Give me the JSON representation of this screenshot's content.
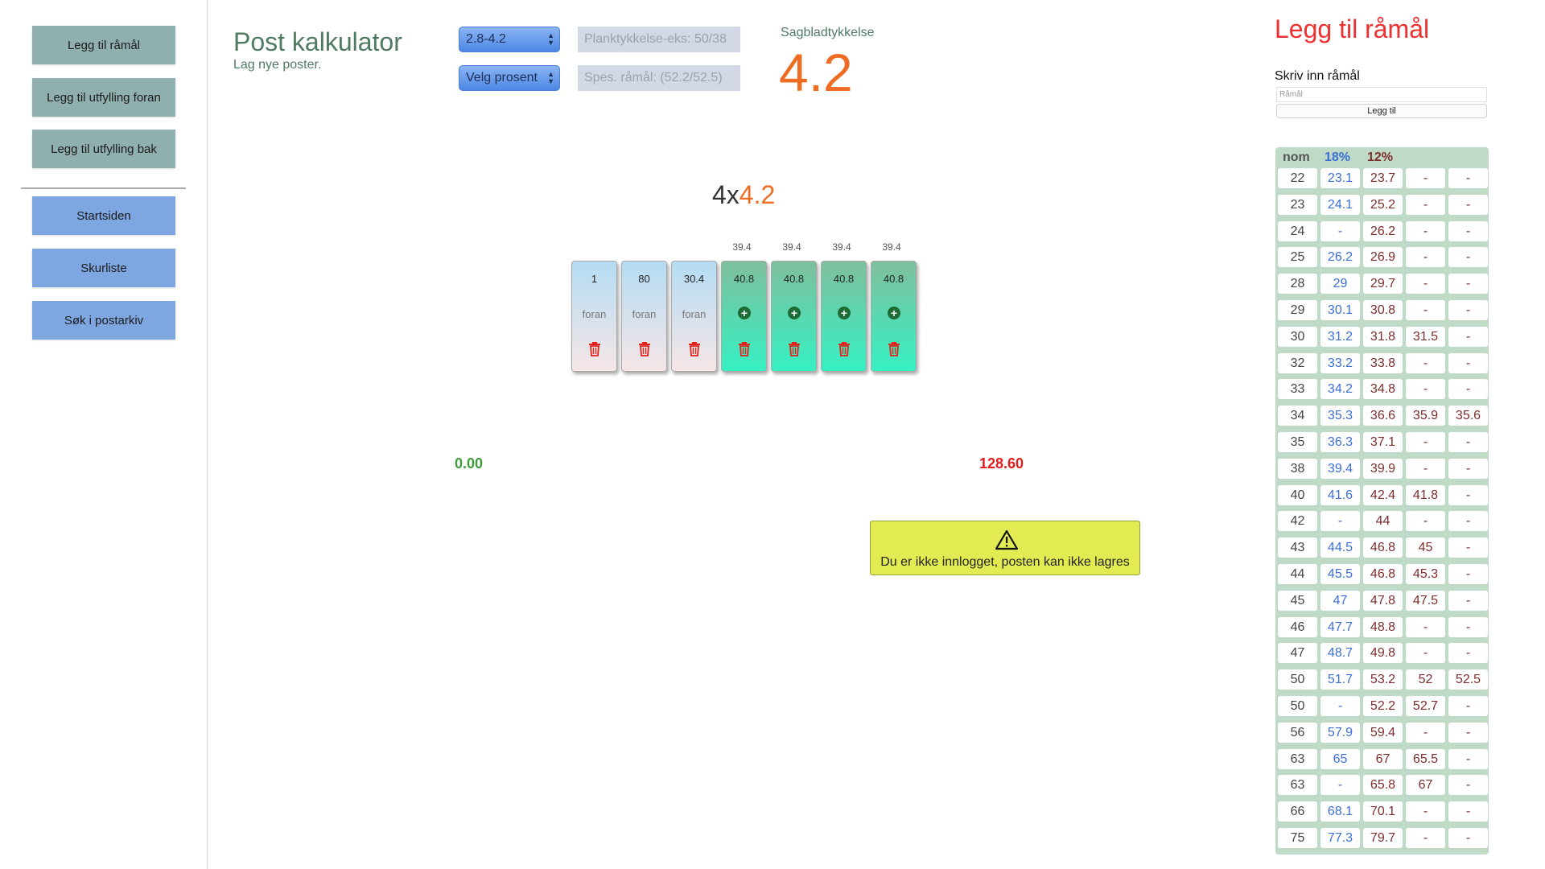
{
  "sidebar": {
    "top_buttons": [
      "Legg til råmål",
      "Legg til utfylling foran",
      "Legg til utfylling bak"
    ],
    "nav_buttons": [
      "Startsiden",
      "Skurliste",
      "Søk i postarkiv"
    ]
  },
  "header": {
    "title": "Post kalkulator",
    "subtitle": "Lag nye poster.",
    "range_select": "2.8-4.2",
    "percent_select": "Velg prosent",
    "plank_placeholder": "Planktykkelse-eks: 50/38",
    "spec_placeholder": "Spes. råmål: (52.2/52.5)",
    "blade_label": "Sagbladtykkelse",
    "blade_value": "4.2"
  },
  "post": {
    "count_prefix": "4x",
    "count_value": "4.2",
    "slot_tops": [
      "39.4",
      "39.4",
      "39.4",
      "39.4"
    ],
    "front_cards": [
      {
        "value": "1",
        "label": "foran"
      },
      {
        "value": "80",
        "label": "foran"
      },
      {
        "value": "30.4",
        "label": "foran"
      }
    ],
    "back_cards": [
      {
        "value": "40.8"
      },
      {
        "value": "40.8"
      },
      {
        "value": "40.8"
      },
      {
        "value": "40.8"
      }
    ],
    "total_left": "0.00",
    "total_right": "128.60",
    "warning": "Du er ikke innlogget, posten kan ikke lagres"
  },
  "right": {
    "title": "Legg til råmål",
    "label": "Skriv inn råmål",
    "placeholder": "Råmål",
    "button": "Legg til",
    "table_headers": [
      "nom",
      "18%",
      "12%"
    ],
    "header_colors": [
      "#555555",
      "#3c6fd6",
      "#7e2d2d"
    ],
    "rows": [
      [
        "22",
        "23.1",
        "23.7",
        "-",
        "-"
      ],
      [
        "23",
        "24.1",
        "25.2",
        "-",
        "-"
      ],
      [
        "24",
        "-",
        "26.2",
        "-",
        "-"
      ],
      [
        "25",
        "26.2",
        "26.9",
        "-",
        "-"
      ],
      [
        "28",
        "29",
        "29.7",
        "-",
        "-"
      ],
      [
        "29",
        "30.1",
        "30.8",
        "-",
        "-"
      ],
      [
        "30",
        "31.2",
        "31.8",
        "31.5",
        "-"
      ],
      [
        "32",
        "33.2",
        "33.8",
        "-",
        "-"
      ],
      [
        "33",
        "34.2",
        "34.8",
        "-",
        "-"
      ],
      [
        "34",
        "35.3",
        "36.6",
        "35.9",
        "35.6"
      ],
      [
        "35",
        "36.3",
        "37.1",
        "-",
        "-"
      ],
      [
        "38",
        "39.4",
        "39.9",
        "-",
        "-"
      ],
      [
        "40",
        "41.6",
        "42.4",
        "41.8",
        "-"
      ],
      [
        "42",
        "-",
        "44",
        "-",
        "-"
      ],
      [
        "43",
        "44.5",
        "46.8",
        "45",
        "-"
      ],
      [
        "44",
        "45.5",
        "46.8",
        "45.3",
        "-"
      ],
      [
        "45",
        "47",
        "47.8",
        "47.5",
        "-"
      ],
      [
        "46",
        "47.7",
        "48.8",
        "-",
        "-"
      ],
      [
        "47",
        "48.7",
        "49.8",
        "-",
        "-"
      ],
      [
        "50",
        "51.7",
        "53.2",
        "52",
        "52.5"
      ],
      [
        "50",
        "-",
        "52.2",
        "52.7",
        "-"
      ],
      [
        "56",
        "57.9",
        "59.4",
        "-",
        "-"
      ],
      [
        "63",
        "65",
        "67",
        "65.5",
        "-"
      ],
      [
        "63",
        "-",
        "65.8",
        "67",
        "-"
      ],
      [
        "66",
        "68.1",
        "70.1",
        "-",
        "-"
      ],
      [
        "75",
        "77.3",
        "79.7",
        "-",
        "-"
      ]
    ]
  }
}
